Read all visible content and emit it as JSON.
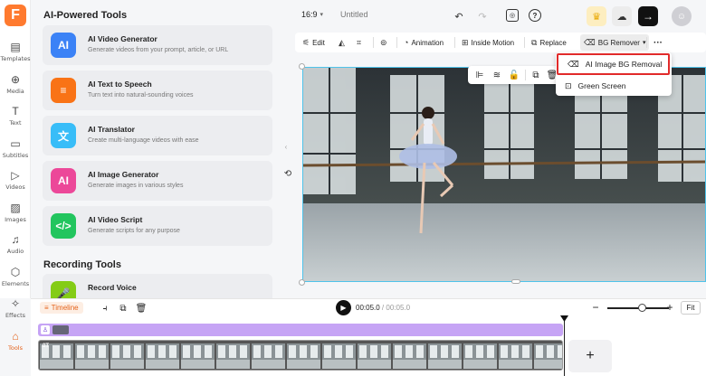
{
  "rail": {
    "items": [
      {
        "label": "Templates",
        "icon": "templates-icon"
      },
      {
        "label": "Media",
        "icon": "media-icon"
      },
      {
        "label": "Text",
        "icon": "text-icon"
      },
      {
        "label": "Subtitles",
        "icon": "subtitles-icon"
      },
      {
        "label": "Videos",
        "icon": "videos-icon"
      },
      {
        "label": "Images",
        "icon": "images-icon"
      },
      {
        "label": "Audio",
        "icon": "audio-icon"
      },
      {
        "label": "Elements",
        "icon": "elements-icon"
      },
      {
        "label": "Effects",
        "icon": "effects-icon"
      },
      {
        "label": "Tools",
        "icon": "tools-icon"
      }
    ],
    "logo_letter": "F"
  },
  "panel": {
    "section_ai": "AI-Powered Tools",
    "cards": [
      {
        "title": "AI Video Generator",
        "desc": "Generate videos from your prompt, article, or URL",
        "badge": "AI",
        "color": "#3b82f6"
      },
      {
        "title": "AI Text to Speech",
        "desc": "Turn text into natural-sounding voices",
        "badge": "≡",
        "color": "#f97316"
      },
      {
        "title": "AI Translator",
        "desc": "Create multi-language videos with ease",
        "badge": "文",
        "color": "#38bdf8"
      },
      {
        "title": "AI Image Generator",
        "desc": "Generate images in various styles",
        "badge": "AI",
        "color": "#ec4899"
      },
      {
        "title": "AI Video Script",
        "desc": "Generate scripts for any purpose",
        "badge": "</>",
        "color": "#22c55e"
      }
    ],
    "section_recording": "Recording Tools",
    "recording_card": {
      "title": "Record Voice",
      "color": "#84cc16"
    }
  },
  "topbar": {
    "aspect": "16:9",
    "title": "Untitled"
  },
  "toolbar": {
    "edit": "Edit",
    "animation": "Animation",
    "inside_motion": "Inside Motion",
    "replace": "Replace",
    "bg_remover": "BG Remover"
  },
  "dropdown": {
    "item1": "AI Image BG Removal",
    "item2": "Green Screen"
  },
  "timeline": {
    "tab": "Timeline",
    "time_current": "00:05.0",
    "time_sep": " / ",
    "time_total": "00:05.0",
    "fit": "Fit",
    "clip_tag": "0T"
  },
  "colors": {
    "accent": "#e5631b",
    "selection": "#4fc3ea",
    "highlight": "#e12a2a"
  }
}
